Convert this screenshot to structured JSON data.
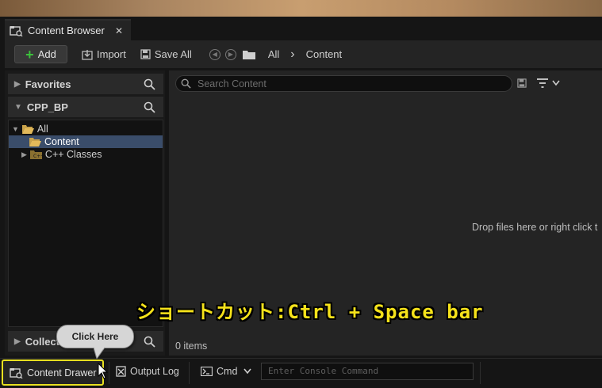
{
  "tab": {
    "title": "Content Browser",
    "close": "✕"
  },
  "toolbar": {
    "add_label": "Add",
    "import_label": "Import",
    "save_all_label": "Save All"
  },
  "breadcrumb": {
    "root": "All",
    "separator": "›",
    "current": "Content"
  },
  "sidebar": {
    "favorites": "Favorites",
    "project": "CPP_BP",
    "collections": "Collect",
    "tree": [
      {
        "label": "All",
        "level": 0,
        "expanded": true
      },
      {
        "label": "Content",
        "level": 1,
        "selected": true
      },
      {
        "label": "C++ Classes",
        "level": 1
      }
    ]
  },
  "search": {
    "placeholder": "Search Content"
  },
  "main": {
    "drop_hint": "Drop files here or right click t",
    "item_count": "0 items"
  },
  "statusbar": {
    "content_drawer": "Content Drawer",
    "output_log": "Output Log",
    "cmd": "Cmd",
    "console_placeholder": "Enter Console Command"
  },
  "overlay": {
    "shortcut_text": "ショートカット:Ctrl + Space bar",
    "callout": "Click Here"
  },
  "colors": {
    "highlight": "#f5e21a",
    "selection": "#3a4d6a",
    "add_plus": "#3cc03c",
    "folder": "#c9a24a"
  }
}
